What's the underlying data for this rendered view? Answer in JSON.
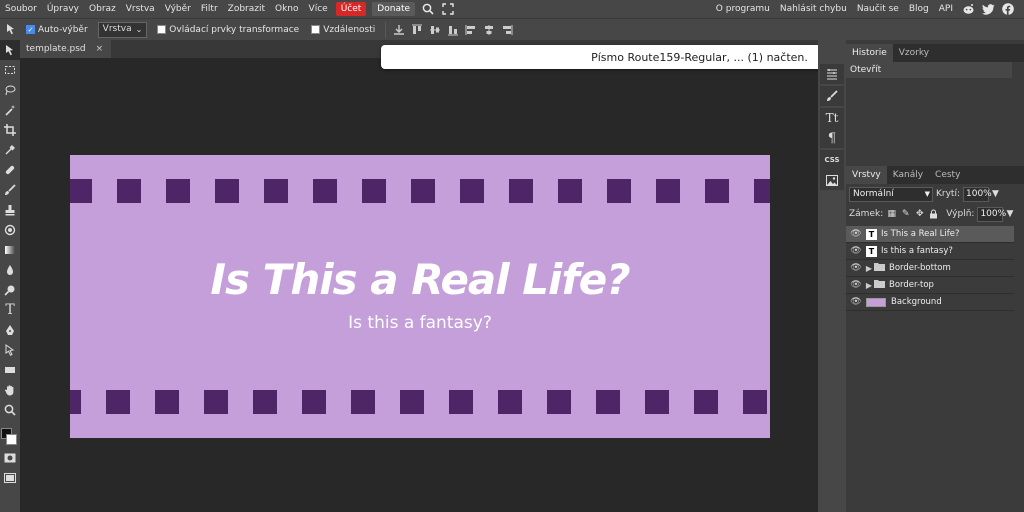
{
  "menu": {
    "items": [
      "Soubor",
      "Úpravy",
      "Obraz",
      "Vrstva",
      "Výběr",
      "Filtr",
      "Zobrazit",
      "Okno",
      "Více"
    ],
    "account": "Účet",
    "donate": "Donate",
    "right_items": [
      "O programu",
      "Nahlásit chybu",
      "Naučit se",
      "Blog",
      "API"
    ]
  },
  "options": {
    "auto_select_label": "Auto-výběr",
    "auto_select_checked": true,
    "target_select": "Vrstva",
    "transform_controls_label": "Ovládací prvky transformace",
    "distances_label": "Vzdálenosti"
  },
  "document": {
    "tab_name": "template.psd",
    "close": "×"
  },
  "artwork": {
    "title": "Is This a Real Life?",
    "subtitle": "Is this a fantasy?",
    "background_color": "#c49fd9",
    "square_color": "#4e2668"
  },
  "toast": {
    "message": "Písmo Route159-Regular, ... (1) načten."
  },
  "history_panel": {
    "tabs": [
      "Historie",
      "Vzorky"
    ],
    "active_tab": "Historie",
    "items": [
      "Otevřít"
    ]
  },
  "layers_panel": {
    "tabs": [
      "Vrstvy",
      "Kanály",
      "Cesty"
    ],
    "active_tab": "Vrstvy",
    "blend_mode": "Normální",
    "opacity_label": "Krytí:",
    "opacity_value": "100%",
    "lock_label": "Zámek:",
    "fill_label": "Výplň:",
    "fill_value": "100%",
    "layers": [
      {
        "name": "Is This a Real Life?",
        "type": "text",
        "selected": true
      },
      {
        "name": "Is this a fantasy?",
        "type": "text",
        "selected": false
      },
      {
        "name": "Border-bottom",
        "type": "folder",
        "selected": false
      },
      {
        "name": "Border-top",
        "type": "folder",
        "selected": false
      },
      {
        "name": "Background",
        "type": "image",
        "selected": false
      }
    ]
  },
  "midcol": {
    "css_label": "CSS",
    "text_label": "Tt",
    "para_label": "¶"
  },
  "toolbar": {
    "type_tool_label": "T"
  },
  "icons": [
    "move-icon",
    "marquee-icon",
    "lasso-icon",
    "wand-icon",
    "crop-icon",
    "eyedropper-icon",
    "heal-icon",
    "brush-icon",
    "stamp-icon",
    "eraser-icon",
    "gradient-icon",
    "blur-icon",
    "dodge-icon",
    "type-icon",
    "pen-icon",
    "path-select-icon",
    "shape-icon",
    "hand-icon",
    "zoom-icon"
  ]
}
